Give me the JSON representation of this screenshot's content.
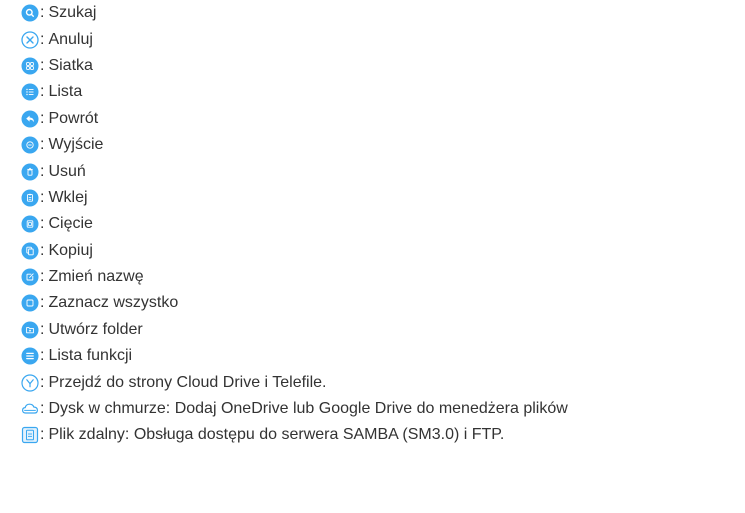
{
  "accent_color": "#3aa7f0",
  "items": [
    {
      "icon": "search-icon",
      "label": "Szukaj"
    },
    {
      "icon": "cancel-icon",
      "label": "Anuluj"
    },
    {
      "icon": "grid-icon",
      "label": "Siatka"
    },
    {
      "icon": "list-icon",
      "label": "Lista"
    },
    {
      "icon": "back-icon",
      "label": "Powrót"
    },
    {
      "icon": "exit-icon",
      "label": "Wyjście"
    },
    {
      "icon": "trash-icon",
      "label": "Usuń"
    },
    {
      "icon": "paste-icon",
      "label": "Wklej"
    },
    {
      "icon": "cut-icon",
      "label": "Cięcie"
    },
    {
      "icon": "copy-icon",
      "label": "Kopiuj"
    },
    {
      "icon": "rename-icon",
      "label": "Zmień nazwę"
    },
    {
      "icon": "select-all-icon",
      "label": "Zaznacz wszystko"
    },
    {
      "icon": "new-folder-icon",
      "label": "Utwórz folder"
    },
    {
      "icon": "menu-icon",
      "label": "Lista funkcji"
    },
    {
      "icon": "cloud-telefile-icon",
      "label": "Przejdź do strony Cloud Drive i Telefile."
    },
    {
      "icon": "cloud-icon",
      "label": "Dysk w chmurze: Dodaj OneDrive lub Google Drive do menedżera plików"
    },
    {
      "icon": "remote-file-icon",
      "label": "Plik zdalny: Obsługa dostępu do serwera SAMBA (SM3.0) i FTP."
    }
  ],
  "separator": ":"
}
